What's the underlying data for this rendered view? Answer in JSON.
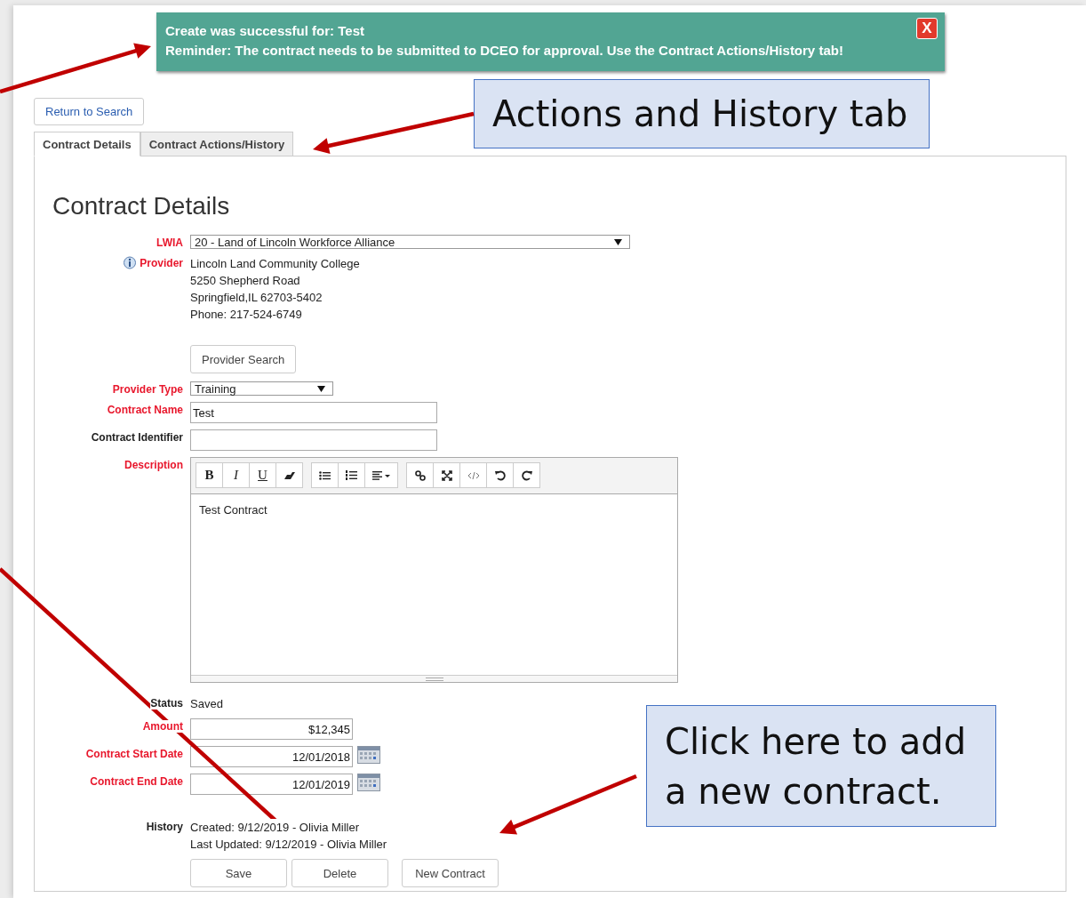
{
  "notification": {
    "lines": [
      "Create was successful for: Test",
      "Reminder: The contract needs to be submitted to DCEO for approval. Use the Contract Actions/History tab!"
    ],
    "close": "X"
  },
  "return_button": "Return to Search",
  "tabs": [
    {
      "label": "Contract Details",
      "selected": true
    },
    {
      "label": "Contract Actions/History",
      "selected": false
    }
  ],
  "heading": "Contract Details",
  "fields": [
    {
      "kind": "select",
      "label": "LWIA",
      "required": true,
      "value": "20 - Land of Lincoln Workforce Alliance"
    },
    {
      "kind": "provider",
      "label": "Provider",
      "required": true,
      "lines": [
        "Lincoln Land Community College",
        "5250 Shepherd Road",
        "Springfield,IL  62703-5402",
        "Phone: 217-524-6749"
      ],
      "button": "Provider Search"
    },
    {
      "kind": "select_small",
      "label": "Provider Type",
      "required": true,
      "value": "Training"
    },
    {
      "kind": "input",
      "label": "Contract Name",
      "required": true,
      "value": "Test"
    },
    {
      "kind": "input",
      "label": "Contract Identifier",
      "required": false
    },
    {
      "kind": "editor",
      "label": "Description",
      "required": true,
      "value": "Test Contract",
      "toolbar": [
        [
          {
            "kind": "bold",
            "label": "B"
          },
          {
            "kind": "italic",
            "label": "I"
          },
          {
            "kind": "underline",
            "label": "U"
          },
          {
            "kind": "eraser"
          }
        ],
        [
          {
            "kind": "bullets"
          },
          {
            "kind": "numbers"
          },
          {
            "kind": "align"
          }
        ],
        [
          {
            "kind": "link"
          },
          {
            "kind": "fullscreen"
          },
          {
            "kind": "code"
          },
          {
            "kind": "undo"
          },
          {
            "kind": "redo"
          }
        ]
      ]
    },
    {
      "kind": "text",
      "label": "Status",
      "required": false,
      "value": "Saved"
    },
    {
      "kind": "amount",
      "label": "Amount",
      "required": true,
      "value": "$12,345"
    },
    {
      "kind": "date",
      "label": "Contract Start Date",
      "required": true,
      "value": "12/01/2018"
    },
    {
      "kind": "date",
      "label": "Contract End Date",
      "required": true,
      "value": "12/01/2019"
    },
    {
      "kind": "history",
      "label": "History",
      "required": false,
      "lines": [
        "Created: 9/12/2019 - Olivia Miller",
        "Last Updated: 9/12/2019 - Olivia Miller"
      ]
    }
  ],
  "buttons": [
    "Save",
    "Delete",
    "New Contract"
  ],
  "callouts": [
    {
      "text": "Actions and History tab"
    },
    {
      "text": "Click here to add a new contract."
    }
  ]
}
